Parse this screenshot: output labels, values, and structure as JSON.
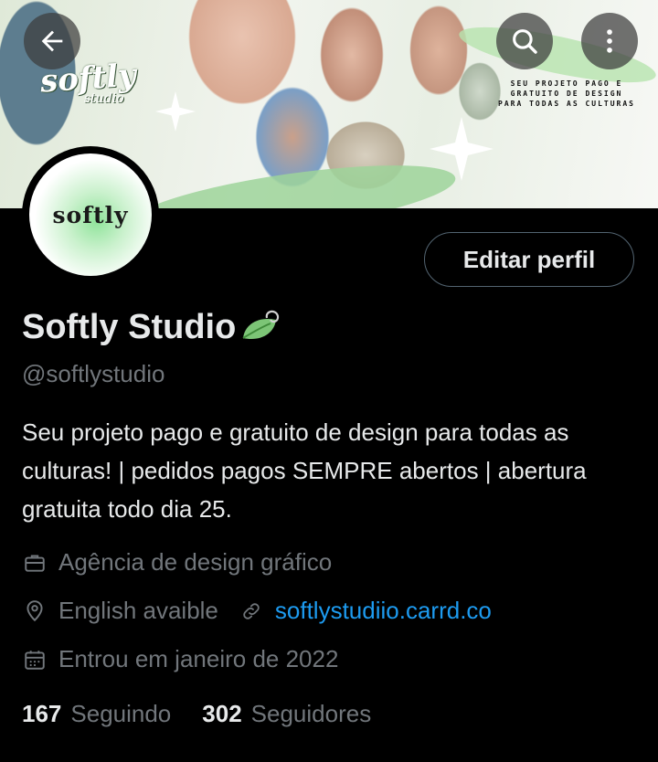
{
  "banner": {
    "logo": "softly",
    "logo_sub": "studio",
    "tagline": [
      "SEU PROJETO PAGO E",
      "GRATUITO DE DESIGN",
      "PARA TODAS AS CULTURAS"
    ],
    "back_icon": "arrow-left-icon",
    "search_icon": "search-icon",
    "more_icon": "more-vertical-icon"
  },
  "avatar": {
    "text": "softly"
  },
  "profile": {
    "edit_label": "Editar perfil",
    "name": "Softly Studio",
    "handle": "@softlystudio",
    "bio": "Seu projeto pago e gratuito de design para todas as culturas! | pedidos pagos SEMPRE abertos | abertura gratuita todo dia 25.",
    "category": "Agência de design gráfico",
    "location": "English avaible",
    "website": "softlystudiio.carrd.co",
    "joined": "Entrou em janeiro de 2022",
    "following_count": "167",
    "following_label": "Seguindo",
    "followers_count": "302",
    "followers_label": "Seguidores"
  },
  "colors": {
    "accent": "#1d9bf0",
    "muted": "#71767b",
    "text": "#e7e9ea",
    "border": "#536471"
  }
}
